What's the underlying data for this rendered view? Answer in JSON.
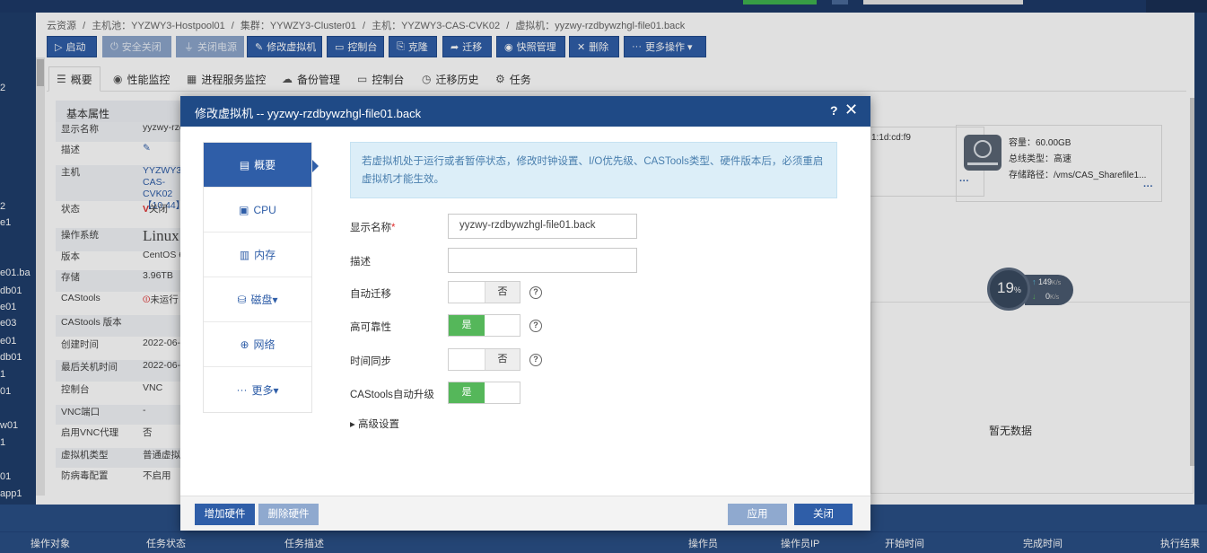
{
  "breadcrumb": [
    "云资源",
    "/",
    "主机池：YYZWY3-Hostpool01",
    "/",
    "集群：YYWZY3-Cluster01",
    "/",
    "主机：YYZWY3-CAS-CVK02",
    "/",
    "虚拟机：yyzwy-rzdbywzhgl-file01.back"
  ],
  "toolbar": [
    {
      "label": "启动",
      "icon": "▷",
      "disabled": false
    },
    {
      "label": "安全关闭",
      "icon": "⏻",
      "disabled": true
    },
    {
      "label": "关闭电源",
      "icon": "⏚",
      "disabled": true
    },
    {
      "label": "修改虚拟机",
      "icon": "✎",
      "disabled": false
    },
    {
      "label": "控制台",
      "icon": "▭",
      "disabled": false
    },
    {
      "label": "克隆",
      "icon": "⎘",
      "disabled": false
    },
    {
      "label": "迁移",
      "icon": "➦",
      "disabled": false
    },
    {
      "label": "快照管理",
      "icon": "◉",
      "disabled": false
    },
    {
      "label": "删除",
      "icon": "✕",
      "disabled": false
    },
    {
      "label": "更多操作",
      "icon": "···",
      "disabled": false
    }
  ],
  "tabs": [
    "概要",
    "性能监控",
    "进程服务监控",
    "备份管理",
    "控制台",
    "迁移历史",
    "任务"
  ],
  "basic": {
    "title": "基本属性",
    "rows": [
      {
        "k": "显示名称",
        "v": "yyzwy-rzdbywzhgl-file01.back"
      },
      {
        "k": "描述",
        "v": "✎"
      },
      {
        "k": "主机",
        "v": "YYZWY3-CAS-CVK02【10.44】"
      },
      {
        "k": "状态",
        "v": "关闭"
      },
      {
        "k": "操作系统",
        "v": "Linux"
      },
      {
        "k": "版本",
        "v": "CentOS 6"
      },
      {
        "k": "存储",
        "v": "3.96TB"
      },
      {
        "k": "CAStools",
        "v": "未运行"
      },
      {
        "k": "CAStools 版本",
        "v": ""
      },
      {
        "k": "创建时间",
        "v": "2022-06-2"
      },
      {
        "k": "最后关机时间",
        "v": "2022-06-2"
      },
      {
        "k": "控制台",
        "v": "VNC"
      },
      {
        "k": "VNC端口",
        "v": "-"
      },
      {
        "k": "启用VNC代理",
        "v": "否"
      },
      {
        "k": "虚拟机类型",
        "v": "普通虚拟机"
      },
      {
        "k": "防病毒配置",
        "v": "不启用"
      }
    ]
  },
  "left_items": [
    "2",
    "2",
    "e1",
    "e01.ba",
    "db01",
    "e01",
    "e03",
    "e01",
    "db01",
    "1",
    "01",
    "w01",
    "1",
    "01",
    "app1"
  ],
  "mac_partial": "1:1d:cd:f9",
  "disk": {
    "capacity": "容量：60.00GB",
    "bus": "总线类型：高速",
    "path": "存储路径：/vms/CAS_Sharefile1..."
  },
  "gauge": {
    "percent": "19",
    "unit": "%",
    "up": "149",
    "down": "0",
    "rate_unit": "K/s"
  },
  "nodata": "暂无数据",
  "bottom_headers": [
    "操作对象",
    "任务状态",
    "任务描述",
    "操作员",
    "操作员IP",
    "开始时间",
    "完成时间",
    "执行结果"
  ],
  "dialog": {
    "title": "修改虚拟机 -- yyzwy-rzdbywzhgl-file01.back",
    "help": "?",
    "close": "✕",
    "nav": [
      {
        "label": "概要",
        "icon": "▤"
      },
      {
        "label": "CPU",
        "icon": "▣"
      },
      {
        "label": "内存",
        "icon": "▥"
      },
      {
        "label": "磁盘▾",
        "icon": "⛁"
      },
      {
        "label": "网络",
        "icon": "⊕"
      },
      {
        "label": "更多▾",
        "icon": "···"
      }
    ],
    "notice": "若虚拟机处于运行或者暂停状态，修改时钟设置、I/O优先级、CASTools类型、硬件版本后，必须重启虚拟机才能生效。",
    "fields": {
      "display_name_label": "显示名称",
      "display_name_value": "yyzwy-rzdbywzhgl-file01.back",
      "description_label": "描述",
      "description_value": "",
      "auto_migrate_label": "自动迁移",
      "auto_migrate_value": "否",
      "ha_label": "高可靠性",
      "ha_value": "是",
      "time_sync_label": "时间同步",
      "time_sync_value": "否",
      "castools_upgrade_label": "CAStools自动升级",
      "castools_upgrade_value": "是"
    },
    "advanced": "▸ 高级设置",
    "buttons": {
      "add_hw": "增加硬件",
      "del_hw": "删除硬件",
      "apply": "应用",
      "close": "关闭"
    }
  },
  "colors": {
    "primary": "#2f5ea8",
    "header": "#1f4a86",
    "toggle_on": "#55b75a",
    "notice_bg": "#dceef8"
  }
}
